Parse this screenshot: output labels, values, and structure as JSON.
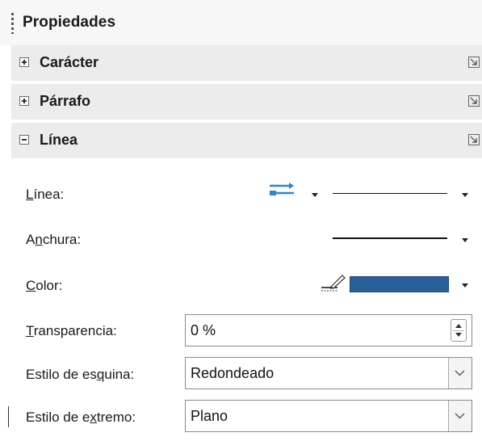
{
  "panel": {
    "title": "Propiedades",
    "sections": [
      {
        "label": "Carácter",
        "expanded": false
      },
      {
        "label": "Párrafo",
        "expanded": false
      },
      {
        "label": "Línea",
        "expanded": true
      }
    ]
  },
  "line": {
    "style_label": {
      "mnemonic": "L",
      "rest": "ínea:"
    },
    "width_label": {
      "pre": "A",
      "mnemonic": "n",
      "rest": "chura:"
    },
    "color_label": {
      "mnemonic": "C",
      "rest": "olor:"
    },
    "color_value": "#2a6099",
    "transparency_label": {
      "mnemonic": "T",
      "rest": "ransparencia:"
    },
    "transparency_value": "0 %",
    "corner_label": {
      "pre": "Estilo de es",
      "mnemonic": "q",
      "rest": "uina:"
    },
    "corner_value": "Redondeado",
    "cap_label": {
      "pre": "Estilo de e",
      "mnemonic": "x",
      "rest": "tremo:"
    },
    "cap_value": "Plano"
  },
  "icons": {
    "grip": "drag-grip-icon",
    "expand": "plus-box-icon",
    "collapse": "minus-box-icon",
    "more_options": "more-options-icon",
    "arrow_style": "arrow-style-icon",
    "line_color": "line-color-icon",
    "dropdown": "chevron-down-icon",
    "spin": "spin-button-icon"
  }
}
